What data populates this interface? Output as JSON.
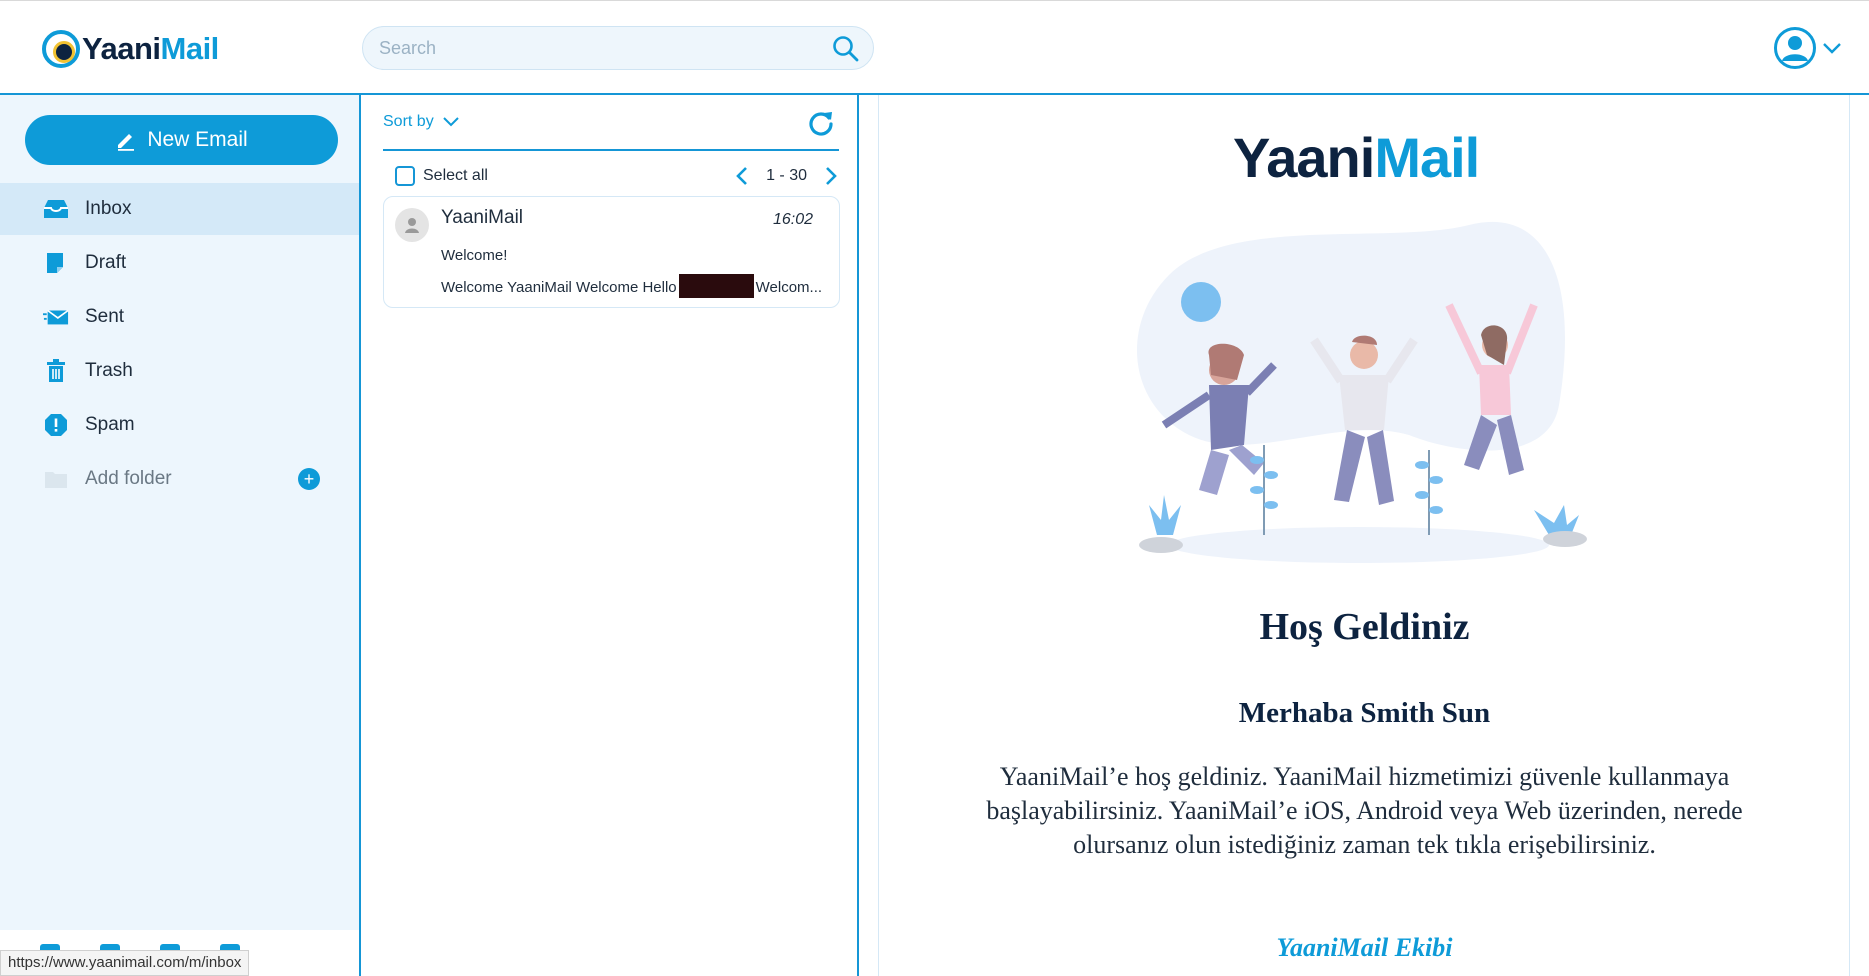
{
  "app": {
    "logo_part1": "Yaani",
    "logo_part2": "Mail"
  },
  "search": {
    "placeholder": "Search"
  },
  "sidebar": {
    "new_email_label": "New Email",
    "folders": [
      {
        "label": "Inbox",
        "icon": "inbox-icon",
        "active": true
      },
      {
        "label": "Draft",
        "icon": "draft-icon"
      },
      {
        "label": "Sent",
        "icon": "sent-icon"
      },
      {
        "label": "Trash",
        "icon": "trash-icon"
      },
      {
        "label": "Spam",
        "icon": "spam-icon"
      }
    ],
    "add_folder_label": "Add folder"
  },
  "list": {
    "sort_label": "Sort by",
    "select_all_label": "Select all",
    "page_range": "1 - 30",
    "messages": [
      {
        "sender": "YaaniMail",
        "time": "16:02",
        "subject": "Welcome!",
        "snippet_start": "Welcome YaaniMail Welcome Hello",
        "snippet_end": "Welcom..."
      }
    ]
  },
  "reader": {
    "logo_part1": "Yaani",
    "logo_part2": "Mail",
    "title": "Hoş Geldiniz",
    "greeting": "Merhaba Smith Sun",
    "body": "YaaniMail’e hoş geldiniz. YaaniMail hizmetimizi güvenle kullanmaya başlayabilirsiniz. YaaniMail’e iOS, Android veya Web üzerinden, nerede olursanız olun istediğiniz zaman tek tıkla erişebilirsiniz.",
    "signature": "YaaniMail Ekibi"
  },
  "status_bar": {
    "url": "https://www.yaanimail.com/m/inbox"
  },
  "colors": {
    "accent": "#0e9bd8",
    "brand_dark": "#0d2340",
    "sidebar_bg": "#edf6fd",
    "active_bg": "#d4e9f8"
  }
}
